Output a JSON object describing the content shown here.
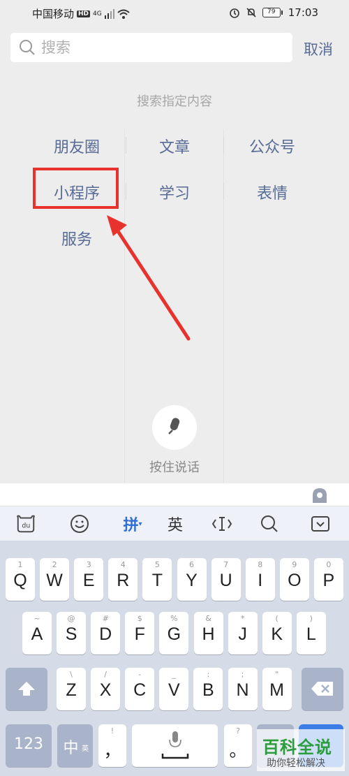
{
  "status": {
    "carrier": "中国移动",
    "hd": "HD",
    "net": "4G",
    "battery": "79",
    "time": "17:03"
  },
  "search": {
    "placeholder": "搜索",
    "cancel": "取消"
  },
  "hint": "搜索指定内容",
  "categories": [
    "朋友圈",
    "文章",
    "公众号",
    "小程序",
    "学习",
    "表情",
    "服务"
  ],
  "voice": {
    "label": "按住说话"
  },
  "keyboard": {
    "toolbar": {
      "pinyin": "拼",
      "english": "英"
    },
    "row1": [
      {
        "n": "1",
        "c": "Q"
      },
      {
        "n": "2",
        "c": "W"
      },
      {
        "n": "3",
        "c": "E"
      },
      {
        "n": "4",
        "c": "R"
      },
      {
        "n": "5",
        "c": "T"
      },
      {
        "n": "6",
        "c": "Y"
      },
      {
        "n": "7",
        "c": "U"
      },
      {
        "n": "8",
        "c": "I"
      },
      {
        "n": "9",
        "c": "O"
      },
      {
        "n": "0",
        "c": "P"
      }
    ],
    "row2": [
      {
        "n": "~",
        "c": "A"
      },
      {
        "n": "@",
        "c": "S"
      },
      {
        "n": "#",
        "c": "D"
      },
      {
        "n": "$",
        "c": "F"
      },
      {
        "n": "%",
        "c": "G"
      },
      {
        "n": "&",
        "c": "H"
      },
      {
        "n": "*",
        "c": "J"
      },
      {
        "n": "(",
        "c": "K"
      },
      {
        "n": ")",
        "c": "L"
      }
    ],
    "row3": [
      {
        "n": "\\",
        "c": "Z"
      },
      {
        "n": "/",
        "c": "X"
      },
      {
        "n": "-",
        "c": "C"
      },
      {
        "n": "_",
        "c": "V"
      },
      {
        "n": ":",
        "c": "B"
      },
      {
        "n": ";",
        "c": "N"
      },
      {
        "n": "\"",
        "c": "M"
      }
    ],
    "num_key": "123",
    "zh_key": "中",
    "zh_sub": "英",
    "comma": {
      "n": "!",
      "c": "，"
    },
    "period": {
      "n": "?",
      "c": "。"
    }
  },
  "watermark": {
    "title": "百科全说",
    "subtitle": "助你轻松解决"
  }
}
